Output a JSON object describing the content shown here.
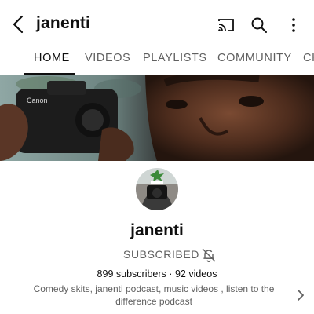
{
  "header": {
    "channel_title": "janenti",
    "icons": [
      "back-arrow-icon",
      "cast-icon",
      "search-icon",
      "more-vert-icon"
    ]
  },
  "tabs": [
    {
      "label": "HOME",
      "active": true
    },
    {
      "label": "VIDEOS",
      "active": false
    },
    {
      "label": "PLAYLISTS",
      "active": false
    },
    {
      "label": "COMMUNITY",
      "active": false
    },
    {
      "label": "CH",
      "active": false
    }
  ],
  "channel": {
    "name": "janenti",
    "subscribe_status": "SUBSCRIBED",
    "subscribers": "899 subscribers",
    "separator": "·",
    "videos": "92 videos",
    "description": "Comedy skits, janenti podcast, music videos , listen to the difference podcast"
  },
  "colors": {
    "text_primary": "#0f0f0f",
    "text_secondary": "#606060",
    "background": "#ffffff"
  }
}
